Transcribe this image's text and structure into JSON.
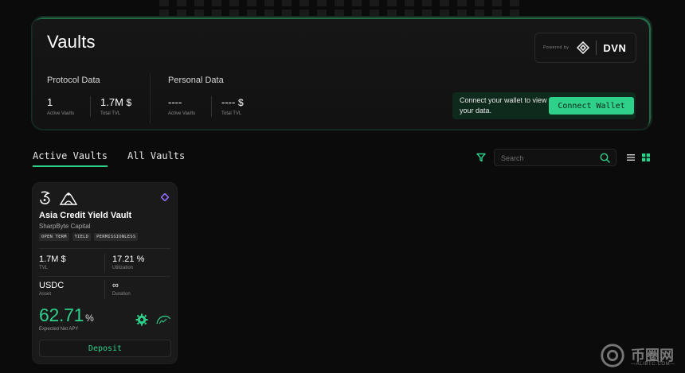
{
  "hero": {
    "title": "Vaults",
    "powered_by": "Powered by",
    "brand": "DVN",
    "protocol_section": "Protocol Data",
    "personal_section": "Personal Data",
    "protocol": {
      "active_vaults_value": "1",
      "active_vaults_label": "Active Vaults",
      "tvl_value": "1.7M",
      "tvl_unit": "$",
      "tvl_label": "Total TVL"
    },
    "personal": {
      "active_vaults_value": "----",
      "active_vaults_label": "Active Vaults",
      "tvl_value": "----",
      "tvl_unit": "$",
      "tvl_label": "Total TVL"
    },
    "connect_text": "Connect your wallet to view your data.",
    "connect_button": "Connect Wallet"
  },
  "tabs": [
    {
      "label": "Active Vaults",
      "active": true
    },
    {
      "label": "All Vaults",
      "active": false
    }
  ],
  "search": {
    "placeholder": "Search"
  },
  "icons": {
    "filter": "filter-icon",
    "search": "search-icon",
    "list_view": "list-icon",
    "grid_view": "grid-icon"
  },
  "colors": {
    "accent": "#2ed08a",
    "background": "#0b0b0b",
    "card": "#1a1a1a",
    "diamond": "#8b6cf2"
  },
  "vault_card": {
    "title": "Asia Credit Yield Vault",
    "manager": "SharpByte Capital",
    "tags": [
      "OPEN TERM",
      "YIELD",
      "PERMISSIONLESS"
    ],
    "tvl_value": "1.7M $",
    "tvl_label": "TVL",
    "utilization_value": "17.21 %",
    "utilization_label": "Utilization",
    "asset_value": "USDC",
    "asset_label": "Asset",
    "duration_value": "∞",
    "duration_label": "Duration",
    "apy_value": "62.71",
    "apy_unit": "%",
    "apy_label": "Expected Net APY",
    "deposit_button": "Deposit"
  },
  "watermark": {
    "text": "币圈网",
    "sub": "—ALIBTC.COM—"
  }
}
